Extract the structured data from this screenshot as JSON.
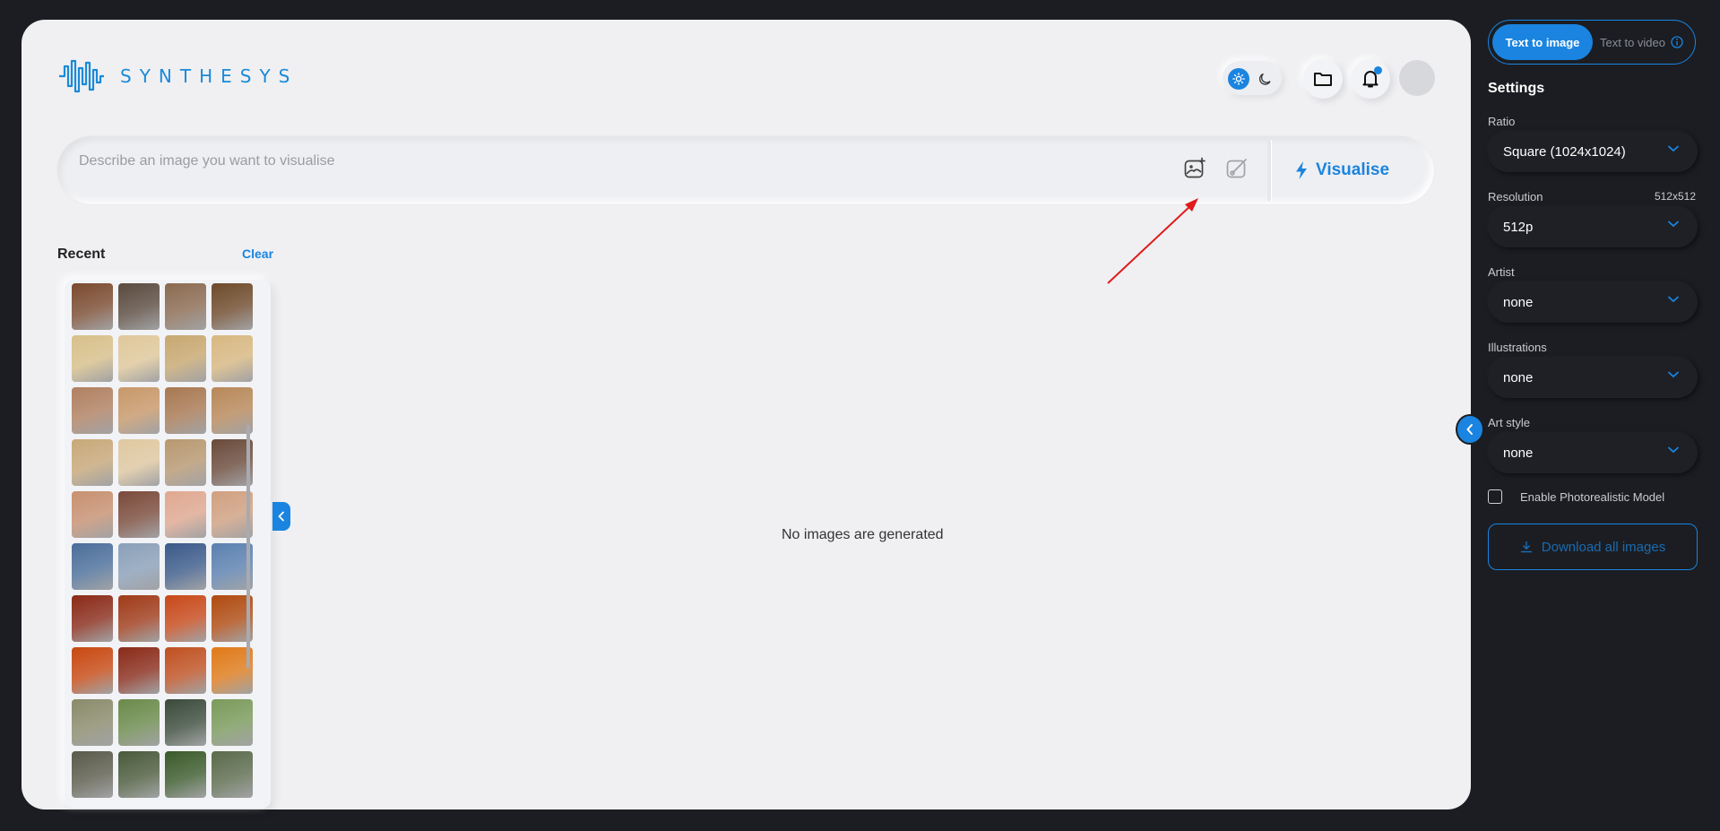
{
  "brand": {
    "name": "SYNTHESYS"
  },
  "header": {
    "theme": "light"
  },
  "prompt": {
    "placeholder": "Describe an image you want to visualise",
    "value": "",
    "submit_label": "Visualise"
  },
  "recent": {
    "title": "Recent",
    "clear_label": "Clear",
    "thumbnails": [
      "#7a4a2e",
      "#5a4a3e",
      "#8a6a50",
      "#6e4a2a",
      "#d8c08a",
      "#e0c89a",
      "#c8a870",
      "#d8b880",
      "#b08060",
      "#c89868",
      "#a87850",
      "#b88858",
      "#c8a878",
      "#e0c8a0",
      "#b89870",
      "#6a4a3a",
      "#c89070",
      "#7a4a3a",
      "#e0a890",
      "#d0a080",
      "#4a6e9a",
      "#8aa0b8",
      "#3a5a8a",
      "#5a80b0",
      "#8a2a18",
      "#a03a18",
      "#c84818",
      "#b04a10",
      "#c84810",
      "#8a2a18",
      "#c05020",
      "#e07a18",
      "#8a8a6a",
      "#6a8a4a",
      "#3a4a3a",
      "#7a9a5a",
      "#5a5a4a",
      "#4a5a3a",
      "#3a5a2a",
      "#5a6a4a"
    ]
  },
  "main": {
    "empty_message": "No images are generated"
  },
  "sidebar": {
    "tabs": {
      "active": "Text to image",
      "inactive": "Text to video"
    },
    "settings_title": "Settings",
    "ratio": {
      "label": "Ratio",
      "value": "Square (1024x1024)"
    },
    "resolution": {
      "label": "Resolution",
      "hint": "512x512",
      "value": "512p"
    },
    "artist": {
      "label": "Artist",
      "value": "none"
    },
    "illustrations": {
      "label": "Illustrations",
      "value": "none"
    },
    "art_style": {
      "label": "Art style",
      "value": "none"
    },
    "photorealistic": {
      "label": "Enable Photorealistic Model",
      "checked": false
    },
    "download_label": "Download all images"
  },
  "colors": {
    "accent": "#1a84e0",
    "annotation": "#e01b1b"
  }
}
